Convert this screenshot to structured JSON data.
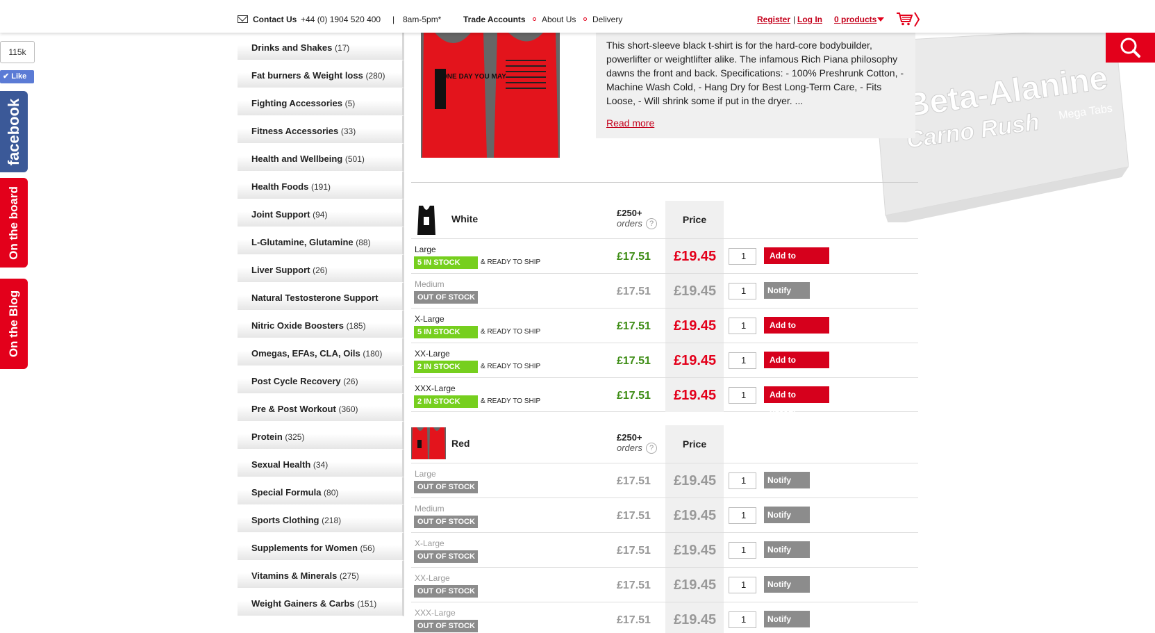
{
  "header": {
    "contact_label": "Contact Us",
    "phone": "+44 (0) 1904 520 400",
    "divider": "|",
    "hours": "8am-5pm*",
    "trade_accounts": "Trade Accounts",
    "about_us": "About Us",
    "delivery": "Delivery",
    "register": "Register",
    "login": "Log In",
    "cart_count": "0 products",
    "accent_color": "#e3001b"
  },
  "social": {
    "like_count": "115k",
    "like_label": "Like",
    "facebook": "facebook",
    "on_the_board": "On the board",
    "on_the_blog": "On the Blog"
  },
  "categories": [
    {
      "name": "Drinks and Shakes",
      "count": "(17)"
    },
    {
      "name": "Fat burners & Weight loss",
      "count": "(280)"
    },
    {
      "name": "Fighting Accessories",
      "count": "(5)"
    },
    {
      "name": "Fitness Accessories",
      "count": "(33)"
    },
    {
      "name": "Health and Wellbeing",
      "count": "(501)"
    },
    {
      "name": "Health Foods",
      "count": "(191)"
    },
    {
      "name": "Joint Support",
      "count": "(94)"
    },
    {
      "name": "L-Glutamine, Glutamine",
      "count": "(88)"
    },
    {
      "name": "Liver Support",
      "count": "(26)"
    },
    {
      "name": "Natural Testosterone Support",
      "count": ""
    },
    {
      "name": "Nitric Oxide Boosters",
      "count": "(185)"
    },
    {
      "name": "Omegas, EFAs, CLA, Oils",
      "count": "(180)"
    },
    {
      "name": "Post Cycle Recovery",
      "count": "(26)"
    },
    {
      "name": "Pre & Post Workout",
      "count": "(360)"
    },
    {
      "name": "Protein",
      "count": "(325)"
    },
    {
      "name": "Sexual Health",
      "count": "(34)"
    },
    {
      "name": "Special Formula",
      "count": "(80)"
    },
    {
      "name": "Sports Clothing",
      "count": "(218)"
    },
    {
      "name": "Supplements for Women",
      "count": "(56)"
    },
    {
      "name": "Vitamins & Minerals",
      "count": "(275)"
    },
    {
      "name": "Weight Gainers & Carbs",
      "count": "(151)"
    }
  ],
  "product": {
    "description": "This short-sleeve black t-shirt is for the hard-core bodybuilder, powerlifter or weightlifter alike. The infamous Rich Piana philosophy dawns the front and back. Specifications: - 100% Preshrunk Cotton, - Machine Wash Cold, - Hang Dry for Best Long-Term Care, - Fits Loose, - Will shrink some if put in the dryer. ...",
    "read_more": "Read more",
    "shirt_front_text": "ONE DAY YOU MAY",
    "promo_title": "Beta-Alanine",
    "promo_subtitle": "Carno Rush",
    "promo_tag": "Mega Tabs"
  },
  "variants": {
    "bulk_label": "£250+",
    "bulk_sub": "orders",
    "price_label": "Price",
    "help": "?",
    "qty_default": "1",
    "ready_label": "& READY TO SHIP",
    "out_label": "OUT OF STOCK",
    "add_label": "Add to basket",
    "notify_label": "Notify me!",
    "bulk_price": "£17.51",
    "price": "£19.45",
    "white": {
      "name": "White",
      "rows": [
        {
          "size": "Large",
          "stock": "5 IN STOCK"
        },
        {
          "size": "Medium",
          "stock": ""
        },
        {
          "size": "X-Large",
          "stock": "5 IN STOCK"
        },
        {
          "size": "XX-Large",
          "stock": "2 IN STOCK"
        },
        {
          "size": "XXX-Large",
          "stock": "2 IN STOCK"
        }
      ]
    },
    "red": {
      "name": "Red",
      "rows": [
        {
          "size": "Large"
        },
        {
          "size": "Medium"
        },
        {
          "size": "X-Large"
        },
        {
          "size": "XX-Large"
        },
        {
          "size": "XXX-Large"
        }
      ]
    }
  }
}
